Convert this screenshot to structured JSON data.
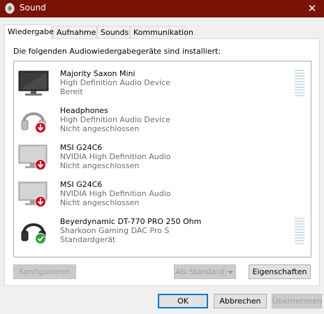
{
  "window": {
    "title": "Sound",
    "close_glyph": "✕"
  },
  "tabs": [
    {
      "label": "Wiedergabe",
      "active": true
    },
    {
      "label": "Aufnahme",
      "active": false
    },
    {
      "label": "Sounds",
      "active": false
    },
    {
      "label": "Kommunikation",
      "active": false
    }
  ],
  "playback": {
    "intro": "Die folgenden Audiowiedergabegeräte sind installiert:",
    "devices": [
      {
        "name": "Majority Saxon Mini",
        "description": "High Definition Audio Device",
        "status": "Bereit",
        "icon": "tv-icon",
        "state": "ready"
      },
      {
        "name": "Headphones",
        "description": "High Definition Audio Device",
        "status": "Nicht angeschlossen",
        "icon": "headphones-icon",
        "state": "disconnected"
      },
      {
        "name": "MSI G24C6",
        "description": "NVIDIA High Definition Audio",
        "status": "Nicht angeschlossen",
        "icon": "monitor-icon",
        "state": "disconnected"
      },
      {
        "name": "MSI G24C6",
        "description": "NVIDIA High Definition Audio",
        "status": "Nicht angeschlossen",
        "icon": "monitor-icon",
        "state": "disconnected"
      },
      {
        "name": "Beyerdynamic DT-770 PRO 250 Ohm",
        "description": "Sharkoon Gaming DAC Pro S",
        "status": "Standardgerät",
        "icon": "headphones-icon",
        "state": "default"
      }
    ],
    "buttons": {
      "configure": "Konfigurieren",
      "set_default": "Als Standard",
      "properties": "Eigenschaften"
    }
  },
  "footer": {
    "ok": "OK",
    "cancel": "Abbrechen",
    "apply": "Übernehmen"
  },
  "colors": {
    "titlebar": "#7a1206",
    "disconnected_badge": "#d0021b",
    "default_badge": "#2aa33a",
    "meter": "#cde0ec"
  }
}
